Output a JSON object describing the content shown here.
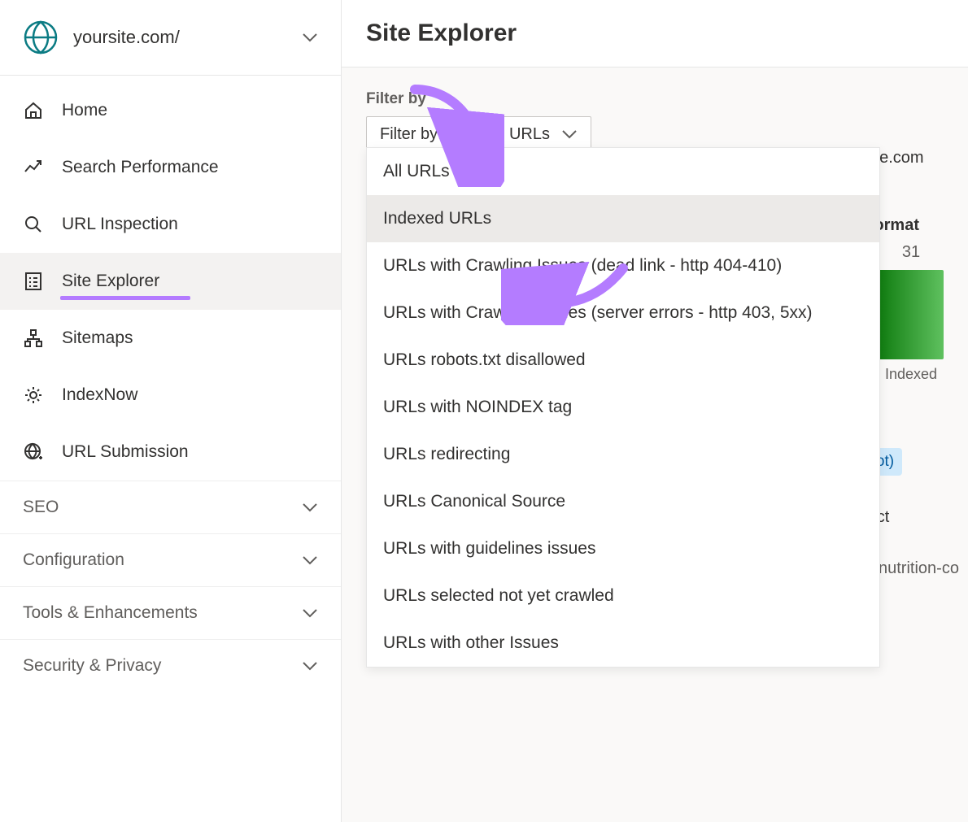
{
  "site": {
    "label": "yoursite.com/"
  },
  "sidebar": {
    "items": [
      {
        "id": "home",
        "label": "Home"
      },
      {
        "id": "search-performance",
        "label": "Search Performance"
      },
      {
        "id": "url-inspection",
        "label": "URL Inspection"
      },
      {
        "id": "site-explorer",
        "label": "Site Explorer",
        "active": true
      },
      {
        "id": "sitemaps",
        "label": "Sitemaps"
      },
      {
        "id": "indexnow",
        "label": "IndexNow"
      },
      {
        "id": "url-submission",
        "label": "URL Submission"
      }
    ],
    "groups": [
      {
        "id": "seo",
        "label": "SEO"
      },
      {
        "id": "configuration",
        "label": "Configuration"
      },
      {
        "id": "tools",
        "label": "Tools & Enhancements"
      },
      {
        "id": "security",
        "label": "Security & Privacy"
      }
    ]
  },
  "header": {
    "title": "Site Explorer"
  },
  "filter": {
    "label": "Filter by",
    "button_label": "Filter by: Indexed URLs",
    "options": [
      "All URLs",
      "Indexed URLs",
      "URLs with Crawling Issues (dead link - http 404-410)",
      "URLs with Crawling Issues (server errors - http 403, 5xx)",
      "URLs robots.txt disallowed",
      "URLs with NOINDEX tag",
      "URLs redirecting",
      "URLs Canonical Source",
      "URLs with guidelines issues",
      "URLs selected not yet crawled",
      "URLs with other Issues"
    ],
    "selected_index": 1
  },
  "peek": {
    "domain_frag": "irsite.com",
    "informat": "informat",
    "count": "31",
    "indexed_label": "Indexed",
    "root_label": "root)",
    "ntact": "ntact",
    "nutrition_frag": "nutrition-co"
  }
}
